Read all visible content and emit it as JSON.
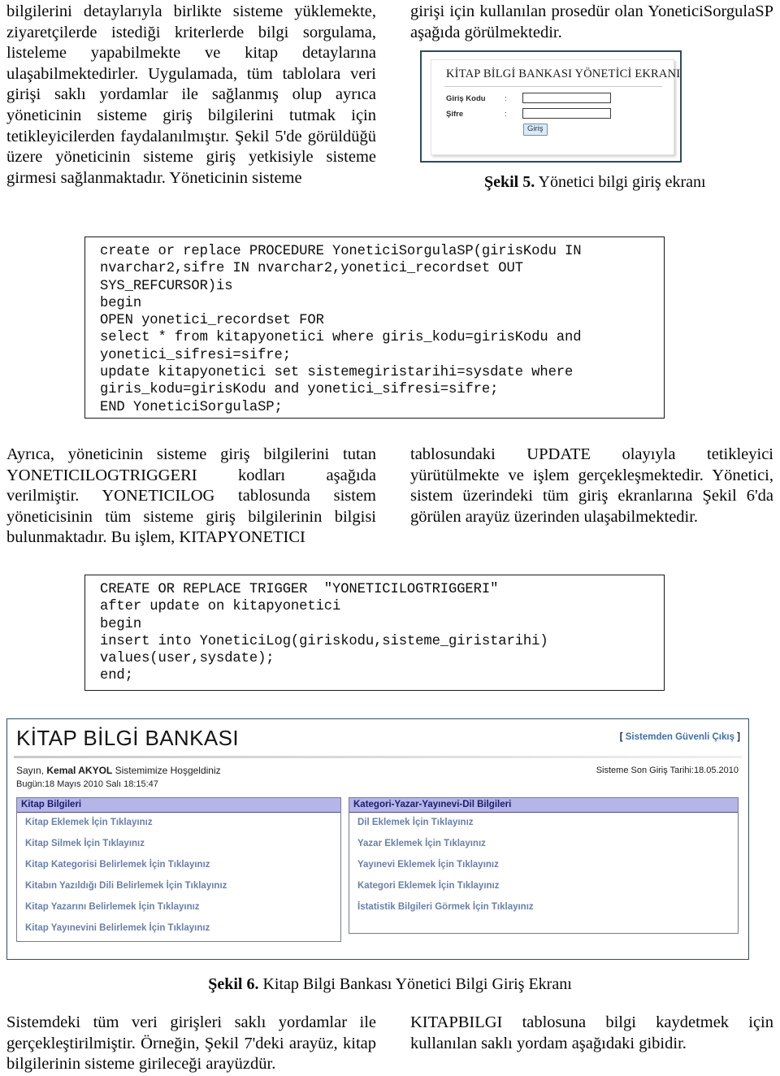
{
  "top_text": {
    "left_column": "bilgilerini detaylarıyla birlikte sisteme yüklemekte, ziyaretçilerde istediği kriterlerde bilgi sorgulama, listeleme yapabilmekte ve kitap detaylarına ulaşabilmektedirler. Uygulamada, tüm tablolara veri girişi saklı yordamlar ile sağlanmış olup ayrıca yöneticinin sisteme giriş bilgilerini tutmak için tetikleyicilerden faydalanılmıştır. Şekil 5'de görüldüğü üzere yöneticinin sisteme giriş yetkisiyle sisteme girmesi sağlanmaktadır. Yöneticinin sisteme",
    "right_column": "girişi için kullanılan prosedür olan YoneticiSorgulaSP aşağıda görülmektedir."
  },
  "figure5": {
    "screen_title": "KİTAP BİLGİ BANKASI YÖNETİCİ EKRANI",
    "fields": [
      {
        "label": "Giriş Kodu",
        "separator": ":",
        "value": ""
      },
      {
        "label": "Şifre",
        "separator": ":",
        "value": ""
      }
    ],
    "submit_label": "Giriş",
    "caption_number": "Şekil 5.",
    "caption_text": " Yönetici bilgi giriş ekranı"
  },
  "code_block_procedure": "create or replace PROCEDURE YoneticiSorgulaSP(girisKodu IN\nnvarchar2,sifre IN nvarchar2,yonetici_recordset OUT\nSYS_REFCURSOR)is\nbegin\nOPEN yonetici_recordset FOR\nselect * from kitapyonetici where giris_kodu=girisKodu and\nyonetici_sifresi=sifre;\nupdate kitapyonetici set sistemegiristarihi=sysdate where\ngiris_kodu=girisKodu and yonetici_sifresi=sifre;\nEND YoneticiSorgulaSP;",
  "middle_text": {
    "left_column": "Ayrıca, yöneticinin sisteme giriş bilgilerini tutan YONETICILOGTRIGGERI kodları aşağıda verilmiştir. YONETICILOG tablosunda sistem yöneticisinin tüm sisteme giriş bilgilerinin bilgisi bulunmaktadır. Bu işlem, KITAPYONETICI",
    "right_column": "tablosundaki UPDATE olayıyla tetikleyici yürütülmekte ve işlem gerçekleşmektedir. Yönetici, sistem üzerindeki tüm giriş ekranlarına Şekil 6'da görülen arayüz üzerinden ulaşabilmektedir."
  },
  "code_block_trigger": "CREATE OR REPLACE TRIGGER  \"YONETICILOGTRIGGERI\"\nafter update on kitapyonetici\nbegin\ninsert into YoneticiLog(giriskodu,sisteme_giristarihi)\nvalues(user,sysdate);\nend;",
  "figure6": {
    "app_title": "KİTAP BİLGİ BANKASI",
    "exit_bracket_open": "[ ",
    "exit_link": "Sistemden Güvenli Çıkış",
    "exit_bracket_close": " ]",
    "welcome_prefix": "Sayın, ",
    "welcome_user": "Kemal AKYOL",
    "welcome_suffix": " Sistemimize Hoşgeldiniz",
    "today_line": "Bugün:18 Mayıs 2010 Salı 18:15:47",
    "last_login": "Sisteme Son Giriş Tarihi:18.05.2010",
    "panel_left": {
      "header": "Kitap Bilgileri",
      "links": [
        "Kitap Eklemek İçin Tıklayınız",
        "Kitap Silmek İçin Tıklayınız",
        "Kitap Kategorisi Belirlemek İçin Tıklayınız",
        "Kitabın Yazıldığı Dili Belirlemek İçin Tıklayınız",
        "Kitap Yazarını Belirlemek İçin Tıklayınız",
        "Kitap Yayınevini Belirlemek İçin Tıklayınız"
      ]
    },
    "panel_right": {
      "header": "Kategori-Yazar-Yayınevi-Dil Bilgileri",
      "links": [
        "Dil Eklemek İçin Tıklayınız",
        "Yazar Eklemek İçin Tıklayınız",
        "Yayınevi Eklemek İçin Tıklayınız",
        "Kategori Eklemek İçin Tıklayınız",
        "İstatistik Bilgileri Görmek İçin Tıklayınız"
      ]
    },
    "caption_number": "Şekil 6.",
    "caption_text": " Kitap Bilgi Bankası Yönetici Bilgi Giriş Ekranı"
  },
  "bottom_text": {
    "left_column": "Sistemdeki tüm veri girişleri saklı yordamlar ile gerçekleştirilmiştir. Örneğin, Şekil 7'deki arayüz, kitap bilgilerinin sisteme girileceği arayüzdür.",
    "right_column": "KITAPBILGI tablosuna bilgi kaydetmek için kullanılan saklı yordam aşağıdaki gibidir."
  },
  "colors": {
    "figure_border": "#2d4f63",
    "panel_header_bg": "#b5b5e8",
    "panel_header_text": "#1c1c6e",
    "link_text": "#6a7fa8",
    "exit_link": "#3f6fa8"
  }
}
